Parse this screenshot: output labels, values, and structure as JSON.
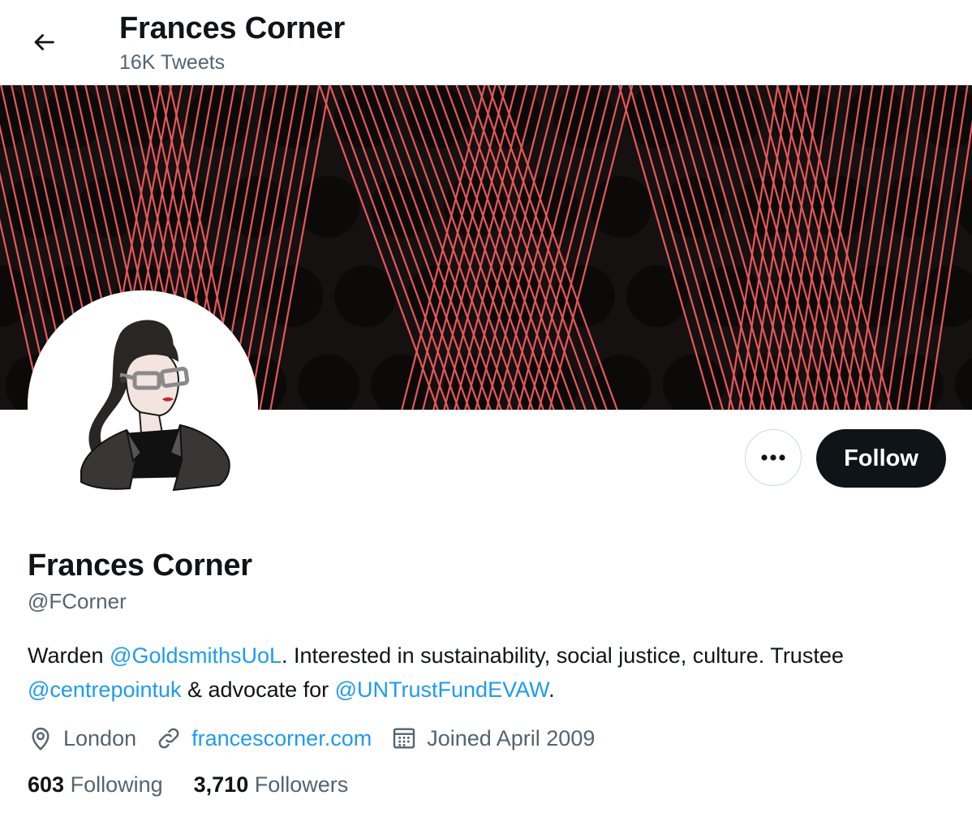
{
  "header": {
    "title": "Frances Corner",
    "tweet_count": "16K Tweets"
  },
  "icons": {
    "back": "arrow-left-icon",
    "more": "more-dots-icon",
    "location": "location-pin-icon",
    "website": "link-icon",
    "joined": "calendar-icon"
  },
  "colors": {
    "accent": "#1d9bf0",
    "banner_background": "#161111",
    "banner_stripes": "#e8575a",
    "follow_button": "#0f1419"
  },
  "actions": {
    "follow_label": "Follow"
  },
  "profile": {
    "name": "Frances Corner",
    "handle": "@FCorner",
    "bio": {
      "t1": "Warden ",
      "m1": "@GoldsmithsUoL",
      "t2": ". Interested in sustainability, social justice, culture. Trustee ",
      "m2": "@centrepointuk",
      "t3": " & advocate for ",
      "m3": "@UNTrustFundEVAW",
      "t4": "."
    },
    "location": "London",
    "website": "francescorner.com",
    "joined": "Joined April 2009"
  },
  "stats": {
    "following_count": "603",
    "following_label": "Following",
    "followers_count": "3,710",
    "followers_label": "Followers"
  }
}
